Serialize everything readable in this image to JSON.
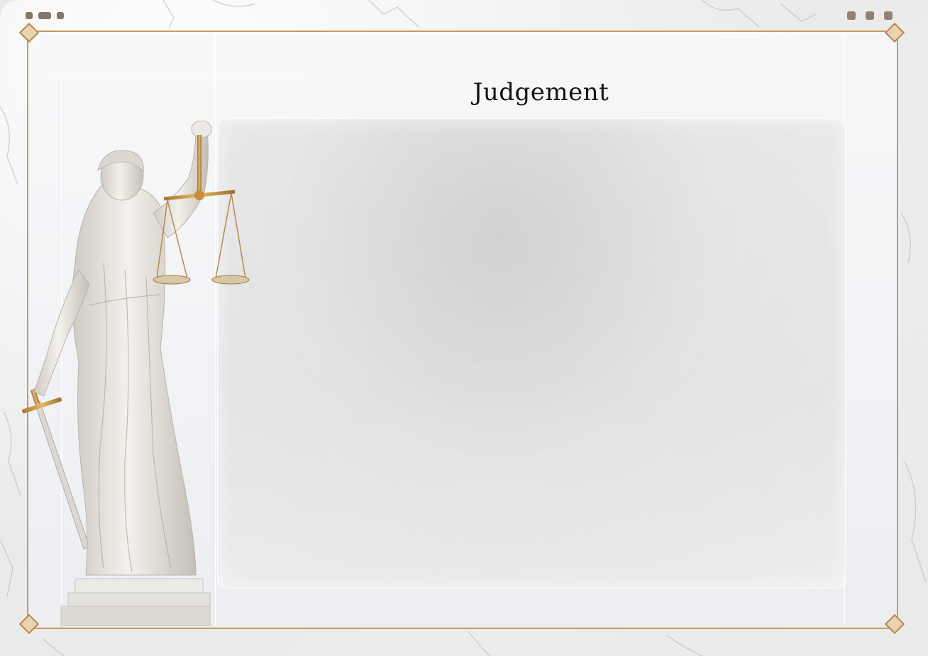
{
  "page": {
    "title": "Judgement"
  },
  "window": {
    "controls": [
      "minimize-icon",
      "maximize-icon",
      "close-icon"
    ]
  },
  "colors": {
    "gold_border": "#c89a5c",
    "marble": "#ececec",
    "panel": "#e2e2e2",
    "title_text": "#141414"
  },
  "decorations": {
    "statue": "lady-justice-statue",
    "scales": "scales-of-justice-icon",
    "sword": "sword-icon"
  }
}
